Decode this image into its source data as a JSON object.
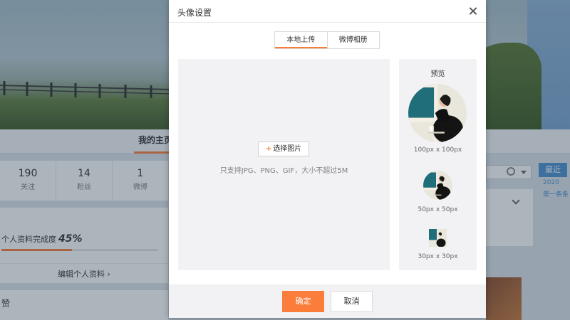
{
  "background": {
    "home_tab": "我的主页",
    "stats": [
      {
        "num": "190",
        "label": "关注"
      },
      {
        "num": "14",
        "label": "粉丝"
      },
      {
        "num": "1",
        "label": "微博"
      }
    ],
    "profile": {
      "completion_label": "个人资料完成度",
      "completion_value": "45%",
      "completion_fraction": 0.45,
      "edit_link": "编辑个人资料 ›"
    },
    "praise_label": "赞",
    "recent_label": "最近",
    "timeline_year": "2020",
    "timeline_entry": "第一条条"
  },
  "modal": {
    "title": "头像设置",
    "tabs": [
      {
        "label": "本地上传",
        "active": true
      },
      {
        "label": "微博相册",
        "active": false
      }
    ],
    "choose_button": "选择图片",
    "upload_hint": "只支持JPG、PNG、GIF，大小不超过5M",
    "preview_title": "预览",
    "previews": [
      {
        "label": "100px x 100px"
      },
      {
        "label": "50px x 50px"
      },
      {
        "label": "30px x 30px"
      }
    ],
    "confirm_button": "确定",
    "cancel_button": "取消"
  },
  "colors": {
    "accent": "#fa7d3c",
    "link_blue": "#4b8ed0"
  }
}
